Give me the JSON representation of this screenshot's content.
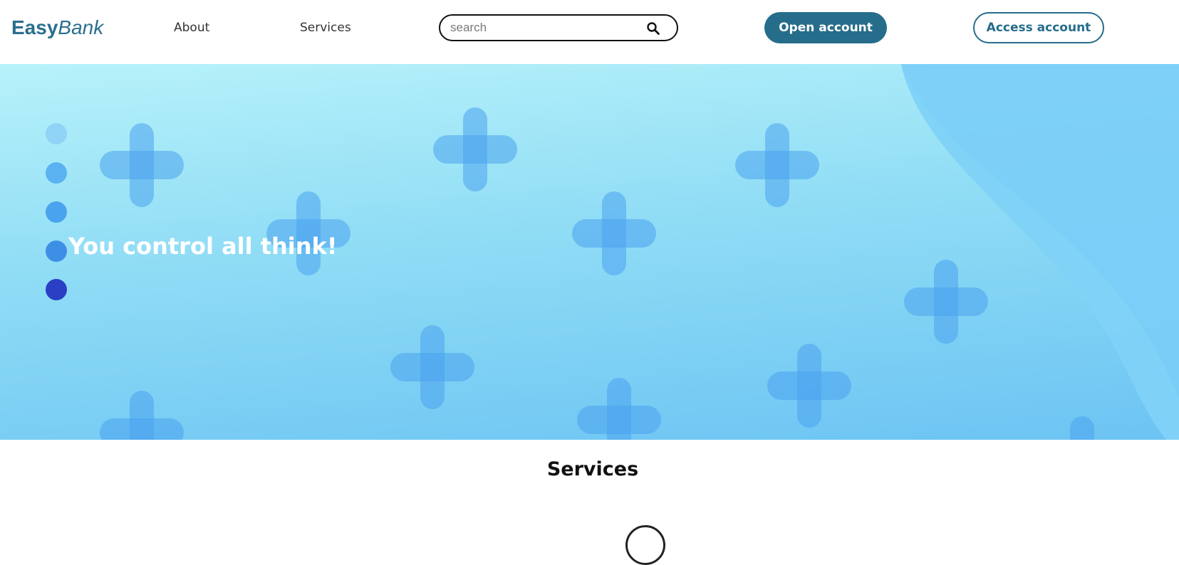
{
  "header": {
    "logo": {
      "bold": "Easy",
      "italic": "Bank"
    },
    "nav": {
      "about": "About",
      "services": "Services"
    },
    "search": {
      "placeholder": "search",
      "value": "",
      "icon": "search-icon"
    },
    "open_account": "Open account",
    "access_account": "Access account"
  },
  "hero": {
    "title": "You control all think!",
    "slider_dots": [
      {
        "color": "#8fd4f7"
      },
      {
        "color": "#5ab3f0"
      },
      {
        "color": "#4aa3ee"
      },
      {
        "color": "#3d8fe6"
      },
      {
        "color": "#2a3fc4"
      }
    ],
    "decoration_icon": "plus-shape-icon"
  },
  "services": {
    "title": "Services"
  },
  "colors": {
    "brand": "#266d8b",
    "hero_light": "#b7f2fa",
    "hero_dark": "#6cc4f3",
    "white": "#ffffff"
  }
}
